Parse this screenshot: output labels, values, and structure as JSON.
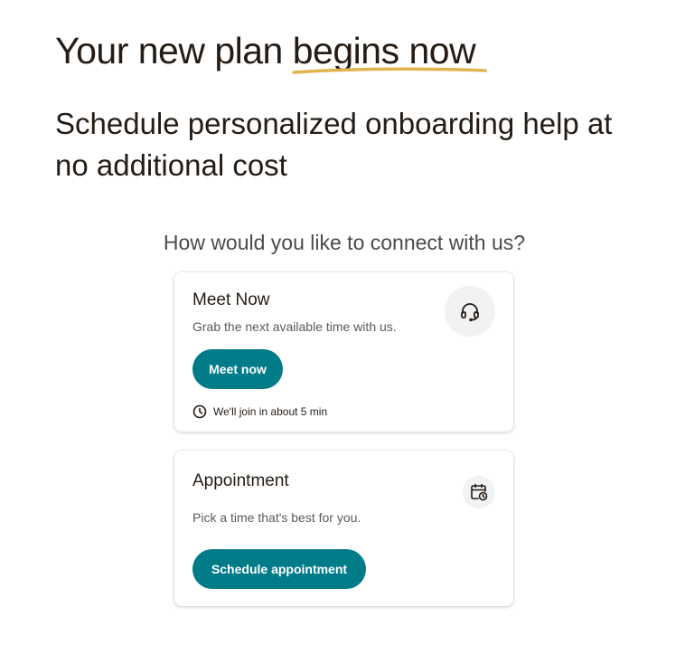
{
  "header": {
    "headline_prefix": "Your new plan ",
    "headline_highlight": "begins now",
    "subheadline": "Schedule personalized onboarding help at no additional cost"
  },
  "connect": {
    "question": "How would you like to connect with us?"
  },
  "meet_now": {
    "title": "Meet Now",
    "description": "Grab the next available time with us.",
    "button_label": "Meet now",
    "eta_text": "We'll join in about 5 min",
    "icon": "headset-icon"
  },
  "appointment": {
    "title": "Appointment",
    "description": "Pick a time that's best for you.",
    "button_label": "Schedule appointment",
    "icon": "calendar-clock-icon"
  },
  "colors": {
    "accent": "#007c89",
    "underline": "#e0b34d",
    "text": "#241c15"
  }
}
